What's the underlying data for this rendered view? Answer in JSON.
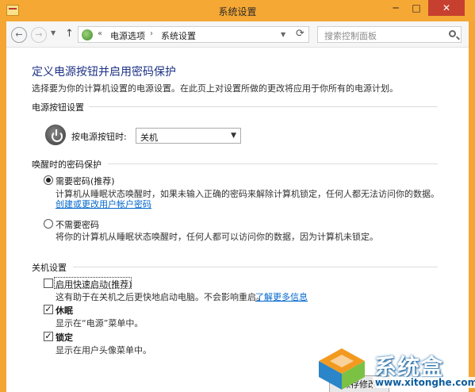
{
  "window": {
    "title": "系统设置",
    "minimize_glyph": "─",
    "maximize_glyph": "□",
    "close_glyph": "✕"
  },
  "nav": {
    "back_glyph": "←",
    "forward_glyph": "→",
    "up_glyph": "↑",
    "breadcrumb_prefix": "«",
    "breadcrumb": [
      "电源选项",
      "系统设置"
    ],
    "breadcrumb_sep": "›",
    "search_placeholder": "搜索控制面板"
  },
  "content": {
    "heading": "定义电源按钮并启用密码保护",
    "description": "选择要为你的计算机设置的电源设置。在此页上对设置所做的更改将应用于你所有的电源计划。",
    "power_section": {
      "title": "电源按钮设置",
      "label": "按电源按钮时:",
      "value": "关机"
    },
    "wake_section": {
      "title": "唤醒时的密码保护",
      "require": {
        "label": "需要密码(推荐)",
        "selected": true,
        "desc": "计算机从睡眠状态唤醒时，如果未输入正确的密码来解除计算机锁定，任何人都无法访问你的数据。",
        "link": "创建或更改用户帐户密码"
      },
      "no_require": {
        "label": "不需要密码",
        "selected": false,
        "desc": "将你的计算机从睡眠状态唤醒时，任何人都可以访问你的数据，因为计算机未锁定。"
      }
    },
    "shutdown_section": {
      "title": "关机设置",
      "fast_startup": {
        "label": "启用快速启动(推荐)",
        "checked": false,
        "desc": "这有助于在关机之后更快地启动电脑。不会影响重启。",
        "link": "了解更多信息"
      },
      "hibernate": {
        "label": "休眠",
        "checked": true,
        "desc": "显示在“电源”菜单中。"
      },
      "lock": {
        "label": "锁定",
        "checked": true,
        "desc": "显示在用户头像菜单中。"
      }
    },
    "save_button": "保存修改"
  },
  "watermark": {
    "brand": "系统盒",
    "url": "www.xitonghe.com"
  },
  "colors": {
    "title_bar": "#f6a834",
    "heading": "#1e3287",
    "link": "#0066cc",
    "close_button": "#c7402f"
  }
}
